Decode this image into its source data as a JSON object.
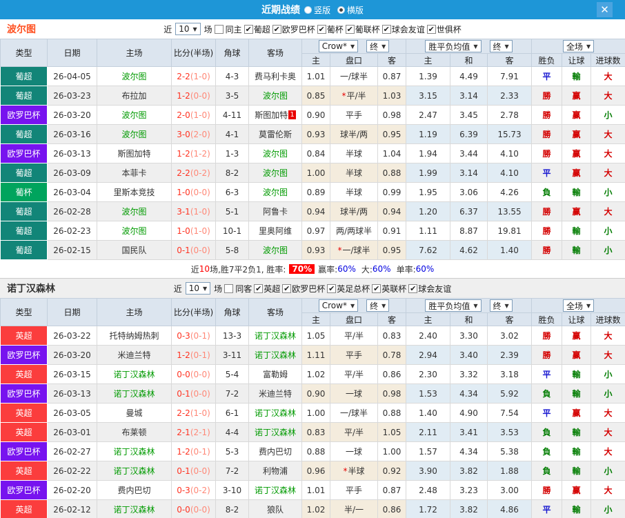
{
  "titlebar": {
    "title": "近期战绩",
    "radio_vertical": "竖版",
    "radio_horizontal": "横版"
  },
  "icons": {
    "check": "✔",
    "arrow": "▼",
    "close": "✕"
  },
  "header": {
    "type": "类型",
    "date": "日期",
    "home": "主场",
    "score_half": "比分(半场)",
    "corner": "角球",
    "away": "客场",
    "sel_company": "Crow*",
    "sel_final": "终",
    "sel_avg": "胜平负均值",
    "sel_final2": "终",
    "sel_scope": "全场",
    "ah_home": "主",
    "ah_line": "盘口",
    "ah_away": "客",
    "eu_home": "主",
    "eu_draw": "和",
    "eu_away": "客",
    "result": "胜负",
    "handicap": "让球",
    "goals": "进球数"
  },
  "league_colors": {
    "葡超": "#128578",
    "欧罗巴杯": "#7713ef",
    "葡杯": "#00a45d",
    "英超": "#fb3d3d"
  },
  "outcome_colors": {
    "勝": "#d40000",
    "平": "#1515d0",
    "負": "#007c00",
    "赢": "#d40000",
    "輸": "#007c00",
    "大": "#d40000",
    "小": "#007c00"
  },
  "sections": [
    {
      "team": "波尔图",
      "filter": {
        "recent_label": "近",
        "count": "10",
        "matches_label": "场",
        "same_label": "同主",
        "leagues": [
          "葡超",
          "欧罗巴杯",
          "葡杯",
          "葡联杯",
          "球会友谊",
          "世俱杯"
        ]
      },
      "rows": [
        {
          "lg": "葡超",
          "date": "26-04-05",
          "home": "波尔图",
          "hs": 1,
          "score": "2-2",
          "half": "(1-0)",
          "cr": "4-3",
          "away": "费马利卡奥",
          "as": 0,
          "ab": "",
          "star": 0,
          "ah": [
            "1.01",
            "一/球半",
            "0.87"
          ],
          "eu": [
            "1.39",
            "4.49",
            "7.91"
          ],
          "res": [
            "平",
            "輸",
            "大"
          ]
        },
        {
          "lg": "葡超",
          "date": "26-03-23",
          "home": "布拉加",
          "hs": 0,
          "score": "1-2",
          "half": "(0-0)",
          "cr": "3-5",
          "away": "波尔图",
          "as": 1,
          "ab": "",
          "star": 1,
          "ah": [
            "0.85",
            "平/半",
            "1.03"
          ],
          "eu": [
            "3.15",
            "3.14",
            "2.33"
          ],
          "res": [
            "勝",
            "赢",
            "大"
          ]
        },
        {
          "lg": "欧罗巴杯",
          "date": "26-03-20",
          "home": "波尔图",
          "hs": 1,
          "score": "2-0",
          "half": "(1-0)",
          "cr": "4-11",
          "away": "斯图加特",
          "as": 0,
          "ab": "1",
          "star": 0,
          "ah": [
            "0.90",
            "平手",
            "0.98"
          ],
          "eu": [
            "2.47",
            "3.45",
            "2.78"
          ],
          "res": [
            "勝",
            "赢",
            "小"
          ]
        },
        {
          "lg": "葡超",
          "date": "26-03-16",
          "home": "波尔图",
          "hs": 1,
          "score": "3-0",
          "half": "(2-0)",
          "cr": "4-1",
          "away": "莫雷伦斯",
          "as": 0,
          "ab": "",
          "star": 0,
          "ah": [
            "0.93",
            "球半/两",
            "0.95"
          ],
          "eu": [
            "1.19",
            "6.39",
            "15.73"
          ],
          "res": [
            "勝",
            "赢",
            "大"
          ]
        },
        {
          "lg": "欧罗巴杯",
          "date": "26-03-13",
          "home": "斯图加特",
          "hs": 0,
          "score": "1-2",
          "half": "(1-2)",
          "cr": "1-3",
          "away": "波尔图",
          "as": 1,
          "ab": "",
          "star": 0,
          "ah": [
            "0.84",
            "半球",
            "1.04"
          ],
          "eu": [
            "1.94",
            "3.44",
            "4.10"
          ],
          "res": [
            "勝",
            "赢",
            "大"
          ]
        },
        {
          "lg": "葡超",
          "date": "26-03-09",
          "home": "本菲卡",
          "hs": 0,
          "score": "2-2",
          "half": "(0-2)",
          "cr": "8-2",
          "away": "波尔图",
          "as": 1,
          "ab": "",
          "star": 0,
          "ah": [
            "1.00",
            "半球",
            "0.88"
          ],
          "eu": [
            "1.99",
            "3.14",
            "4.10"
          ],
          "res": [
            "平",
            "赢",
            "大"
          ]
        },
        {
          "lg": "葡杯",
          "date": "26-03-04",
          "home": "里斯本竞技",
          "hs": 0,
          "score": "1-0",
          "half": "(0-0)",
          "cr": "6-3",
          "away": "波尔图",
          "as": 1,
          "ab": "",
          "star": 0,
          "ah": [
            "0.89",
            "半球",
            "0.99"
          ],
          "eu": [
            "1.95",
            "3.06",
            "4.26"
          ],
          "res": [
            "負",
            "輸",
            "小"
          ]
        },
        {
          "lg": "葡超",
          "date": "26-02-28",
          "home": "波尔图",
          "hs": 1,
          "score": "3-1",
          "half": "(1-0)",
          "cr": "5-1",
          "away": "阿鲁卡",
          "as": 0,
          "ab": "",
          "star": 0,
          "ah": [
            "0.94",
            "球半/两",
            "0.94"
          ],
          "eu": [
            "1.20",
            "6.37",
            "13.55"
          ],
          "res": [
            "勝",
            "赢",
            "大"
          ]
        },
        {
          "lg": "葡超",
          "date": "26-02-23",
          "home": "波尔图",
          "hs": 1,
          "score": "1-0",
          "half": "(1-0)",
          "cr": "10-1",
          "away": "里奥阿维",
          "as": 0,
          "ab": "",
          "star": 0,
          "ah": [
            "0.97",
            "两/两球半",
            "0.91"
          ],
          "eu": [
            "1.11",
            "8.87",
            "19.81"
          ],
          "res": [
            "勝",
            "輸",
            "小"
          ]
        },
        {
          "lg": "葡超",
          "date": "26-02-15",
          "home": "国民队",
          "hs": 0,
          "score": "0-1",
          "half": "(0-0)",
          "cr": "5-8",
          "away": "波尔图",
          "as": 1,
          "ab": "",
          "star": 1,
          "ah": [
            "0.93",
            "一/球半",
            "0.95"
          ],
          "eu": [
            "7.62",
            "4.62",
            "1.40"
          ],
          "res": [
            "勝",
            "輸",
            "小"
          ]
        }
      ],
      "summary": {
        "t1": "近",
        "n": "10",
        "t2": "场,胜7平2负1, 胜率:",
        "rate": "70%",
        "t3": "赢率:",
        "r3": "60%",
        "t4": "大:",
        "r4": "60%",
        "t5": "单率:",
        "r5": "60%"
      }
    },
    {
      "team": "诺丁汉森林",
      "filter": {
        "recent_label": "近",
        "count": "10",
        "matches_label": "场",
        "same_label": "同客",
        "leagues": [
          "英超",
          "欧罗巴杯",
          "英足总杯",
          "英联杯",
          "球会友谊"
        ]
      },
      "rows": [
        {
          "lg": "英超",
          "date": "26-03-22",
          "home": "托特纳姆热刺",
          "hs": 0,
          "score": "0-3",
          "half": "(0-1)",
          "cr": "13-3",
          "away": "诺丁汉森林",
          "as": 1,
          "ab": "",
          "star": 0,
          "ah": [
            "1.05",
            "平/半",
            "0.83"
          ],
          "eu": [
            "2.40",
            "3.30",
            "3.02"
          ],
          "res": [
            "勝",
            "赢",
            "大"
          ]
        },
        {
          "lg": "欧罗巴杯",
          "date": "26-03-20",
          "home": "米迪兰特",
          "hs": 0,
          "score": "1-2",
          "half": "(0-1)",
          "cr": "3-11",
          "away": "诺丁汉森林",
          "as": 1,
          "ab": "",
          "star": 0,
          "ah": [
            "1.11",
            "平手",
            "0.78"
          ],
          "eu": [
            "2.94",
            "3.40",
            "2.39"
          ],
          "res": [
            "勝",
            "赢",
            "大"
          ]
        },
        {
          "lg": "英超",
          "date": "26-03-15",
          "home": "诺丁汉森林",
          "hs": 1,
          "score": "0-0",
          "half": "(0-0)",
          "cr": "5-4",
          "away": "富勒姆",
          "as": 0,
          "ab": "",
          "star": 0,
          "ah": [
            "1.02",
            "平/半",
            "0.86"
          ],
          "eu": [
            "2.30",
            "3.32",
            "3.18"
          ],
          "res": [
            "平",
            "輸",
            "小"
          ]
        },
        {
          "lg": "欧罗巴杯",
          "date": "26-03-13",
          "home": "诺丁汉森林",
          "hs": 1,
          "score": "0-1",
          "half": "(0-0)",
          "cr": "7-2",
          "away": "米迪兰特",
          "as": 0,
          "ab": "",
          "star": 0,
          "ah": [
            "0.90",
            "一球",
            "0.98"
          ],
          "eu": [
            "1.53",
            "4.34",
            "5.92"
          ],
          "res": [
            "負",
            "輸",
            "小"
          ]
        },
        {
          "lg": "英超",
          "date": "26-03-05",
          "home": "曼城",
          "hs": 0,
          "score": "2-2",
          "half": "(1-0)",
          "cr": "6-1",
          "away": "诺丁汉森林",
          "as": 1,
          "ab": "",
          "star": 0,
          "ah": [
            "1.00",
            "一/球半",
            "0.88"
          ],
          "eu": [
            "1.40",
            "4.90",
            "7.54"
          ],
          "res": [
            "平",
            "赢",
            "大"
          ]
        },
        {
          "lg": "英超",
          "date": "26-03-01",
          "home": "布莱顿",
          "hs": 0,
          "score": "2-1",
          "half": "(2-1)",
          "cr": "4-4",
          "away": "诺丁汉森林",
          "as": 1,
          "ab": "",
          "star": 0,
          "ah": [
            "0.83",
            "平/半",
            "1.05"
          ],
          "eu": [
            "2.11",
            "3.41",
            "3.53"
          ],
          "res": [
            "負",
            "輸",
            "大"
          ]
        },
        {
          "lg": "欧罗巴杯",
          "date": "26-02-27",
          "home": "诺丁汉森林",
          "hs": 1,
          "score": "1-2",
          "half": "(0-1)",
          "cr": "5-3",
          "away": "费内巴切",
          "as": 0,
          "ab": "",
          "star": 0,
          "ah": [
            "0.88",
            "一球",
            "1.00"
          ],
          "eu": [
            "1.57",
            "4.34",
            "5.38"
          ],
          "res": [
            "負",
            "輸",
            "大"
          ]
        },
        {
          "lg": "英超",
          "date": "26-02-22",
          "home": "诺丁汉森林",
          "hs": 1,
          "score": "0-1",
          "half": "(0-0)",
          "cr": "7-2",
          "away": "利物浦",
          "as": 0,
          "ab": "",
          "star": 1,
          "ah": [
            "0.96",
            "半球",
            "0.92"
          ],
          "eu": [
            "3.90",
            "3.82",
            "1.88"
          ],
          "res": [
            "負",
            "輸",
            "小"
          ]
        },
        {
          "lg": "欧罗巴杯",
          "date": "26-02-20",
          "home": "费内巴切",
          "hs": 0,
          "score": "0-3",
          "half": "(0-2)",
          "cr": "3-10",
          "away": "诺丁汉森林",
          "as": 1,
          "ab": "",
          "star": 0,
          "ah": [
            "1.01",
            "平手",
            "0.87"
          ],
          "eu": [
            "2.48",
            "3.23",
            "3.00"
          ],
          "res": [
            "勝",
            "赢",
            "大"
          ]
        },
        {
          "lg": "英超",
          "date": "26-02-12",
          "home": "诺丁汉森林",
          "hs": 1,
          "score": "0-0",
          "half": "(0-0)",
          "cr": "8-2",
          "away": "狼队",
          "as": 0,
          "ab": "",
          "star": 0,
          "ah": [
            "1.02",
            "半/一",
            "0.86"
          ],
          "eu": [
            "1.72",
            "3.82",
            "4.86"
          ],
          "res": [
            "平",
            "輸",
            "小"
          ]
        }
      ]
    }
  ]
}
